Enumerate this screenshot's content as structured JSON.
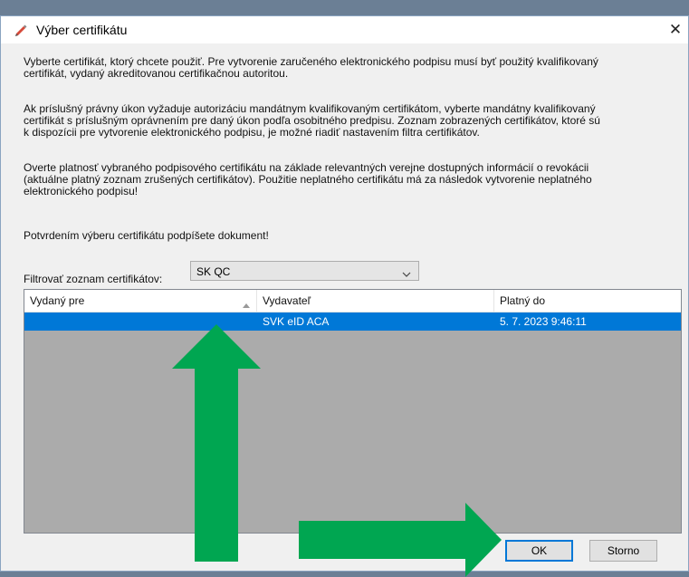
{
  "dialog": {
    "title": "Výber certifikátu",
    "close_symbol": "✕",
    "paragraphs": [
      [
        "Vyberte certifikát, ktorý chcete použiť. Pre vytvorenie zaručeného elektronického podpisu musí byť použitý kvalifikovaný",
        "certifikát, vydaný akreditovanou certifikačnou autoritou."
      ],
      [
        "Ak príslušný právny úkon vyžaduje autorizáciu mandátnym kvalifikovaným certifikátom, vyberte mandátny kvalifikovaný",
        "certifikát s príslušným oprávnením pre daný úkon podľa osobitného predpisu. Zoznam zobrazených certifikátov, ktoré sú",
        "k dispozícii pre vytvorenie elektronického podpisu, je možné riadiť nastavením filtra certifikátov."
      ],
      [
        "Overte platnosť vybraného podpisového certifikátu na základe relevantných verejne dostupných informácií o revokácii",
        "(aktuálne platný zoznam zrušených certifikátov). Použitie neplatného certifikátu má za následok vytvorenie neplatného",
        "elektronického podpisu!"
      ],
      [
        "Potvrdením výberu certifikátu podpíšete dokument!"
      ]
    ]
  },
  "filter": {
    "label": "Filtrovať zoznam certifikátov:",
    "value": "SK QC"
  },
  "table": {
    "columns": [
      "Vydaný pre",
      "Vydavateľ",
      "Platný do"
    ],
    "rows": [
      {
        "issued_to": "",
        "issuer": "SVK eID ACA",
        "valid_to": "5. 7. 2023 9:46:11",
        "selected": true
      }
    ]
  },
  "buttons": {
    "ok": "OK",
    "cancel": "Storno"
  },
  "colors": {
    "selection": "#0078d7",
    "arrow": "#00a651",
    "list_bg": "#ababab"
  },
  "icons": [
    "certificate-pen-icon",
    "close-icon",
    "chevron-down-icon",
    "sort-ascending-icon"
  ]
}
